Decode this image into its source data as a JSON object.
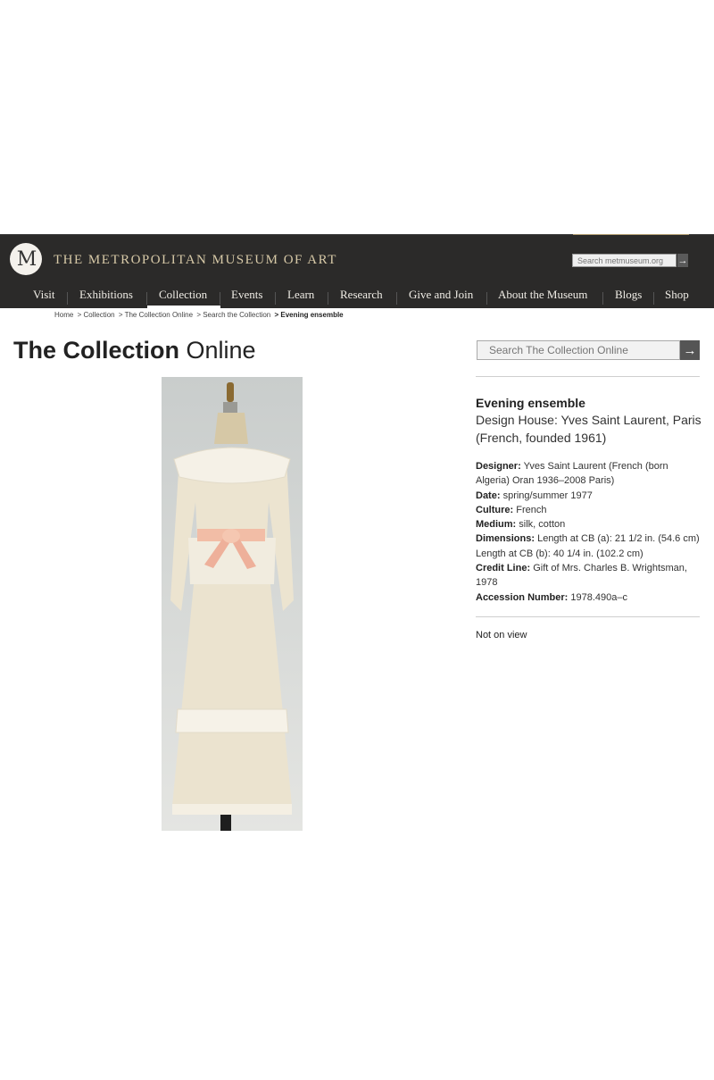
{
  "header": {
    "museum_name": "THE METROPOLITAN MUSEUM OF ART",
    "logo_text": "M",
    "site_search_placeholder": "Search metmuseum.org",
    "bg_color": "#2b2a29",
    "accent_color": "#d7c9a7"
  },
  "nav": {
    "items": [
      "Visit",
      "Exhibitions",
      "Collection",
      "Events",
      "Learn",
      "Research",
      "Give and Join",
      "About the Museum",
      "Blogs",
      "Shop"
    ],
    "active": "Collection"
  },
  "breadcrumb": {
    "items": [
      "Home",
      "> Collection",
      "> The Collection Online",
      "> Search the Collection"
    ],
    "current": "> Evening ensemble"
  },
  "page": {
    "title_bold": "The Collection",
    "title_light": "Online",
    "collection_search_placeholder": "Search The Collection Online"
  },
  "object": {
    "title": "Evening ensemble",
    "maker": "Design House: Yves Saint Laurent, Paris (French, founded 1961)",
    "details": [
      {
        "label": "Designer:",
        "value": "Yves Saint Laurent (French (born Algeria) Oran 1936–2008 Paris)"
      },
      {
        "label": "Date:",
        "value": "spring/summer 1977"
      },
      {
        "label": "Culture:",
        "value": "French"
      },
      {
        "label": "Medium:",
        "value": "silk, cotton"
      },
      {
        "label": "Dimensions:",
        "value": "Length at CB (a): 21 1/2 in. (54.6 cm) Length at CB (b): 40 1/4 in. (102.2 cm)"
      },
      {
        "label": "Credit Line:",
        "value": "Gift of Mrs. Charles B. Wrightsman, 1978"
      },
      {
        "label": "Accession Number:",
        "value": "1978.490a–c"
      }
    ],
    "on_view": "Not on view"
  }
}
